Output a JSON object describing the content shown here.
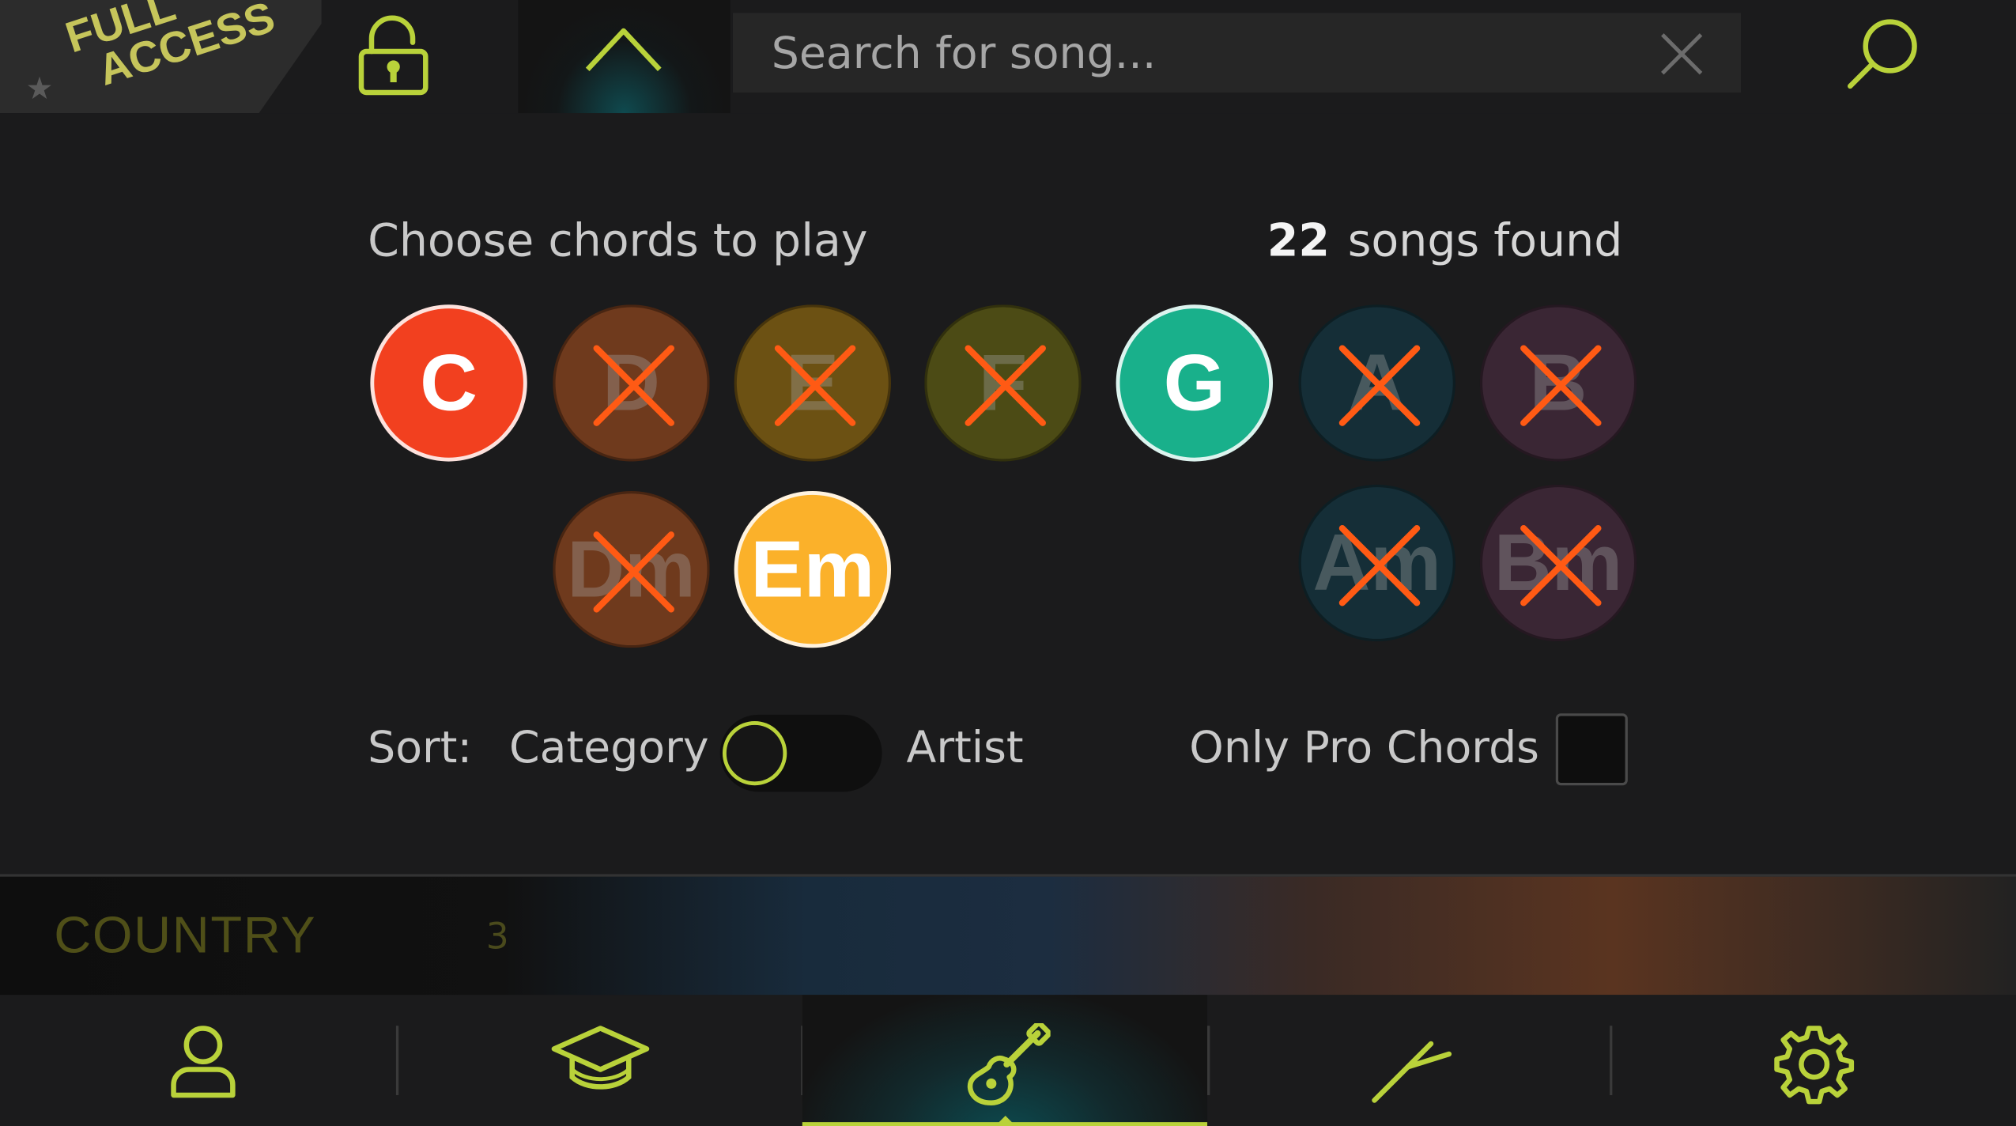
{
  "badge": {
    "line1": "FULL",
    "line2": "ACCESS"
  },
  "search": {
    "placeholder": "Search for song..."
  },
  "panel": {
    "title": "Choose chords to play",
    "songs_found_count": "22",
    "songs_found_label": "songs found"
  },
  "chords": [
    {
      "name": "C",
      "selected": true,
      "color": "#f2401f"
    },
    {
      "name": "D",
      "selected": false,
      "color": "#6f3a1d"
    },
    {
      "name": "E",
      "selected": false,
      "color": "#6c5113"
    },
    {
      "name": "F",
      "selected": false,
      "color": "#4c4b15"
    },
    {
      "name": "G",
      "selected": true,
      "color": "#19b08b"
    },
    {
      "name": "A",
      "selected": false,
      "color": "#152e37"
    },
    {
      "name": "B",
      "selected": false,
      "color": "#3a2634"
    },
    {
      "name": "Dm",
      "selected": false,
      "color": "#6f3a1d"
    },
    {
      "name": "Em",
      "selected": true,
      "color": "#fbb12a"
    },
    {
      "name": "Am",
      "selected": false,
      "color": "#152e37"
    },
    {
      "name": "Bm",
      "selected": false,
      "color": "#3a2634"
    }
  ],
  "sort": {
    "label": "Sort:",
    "option_left": "Category",
    "option_right": "Artist",
    "selected": "Category"
  },
  "pro_chords": {
    "label": "Only Pro Chords",
    "checked": false
  },
  "category_strip": {
    "name": "COUNTRY",
    "count": "3"
  },
  "nav": {
    "items": [
      {
        "name": "profile",
        "icon": "person-icon"
      },
      {
        "name": "lessons",
        "icon": "graduation-cap-icon"
      },
      {
        "name": "songs",
        "icon": "guitar-icon",
        "active": true
      },
      {
        "name": "tuner",
        "icon": "tuning-fork-icon"
      },
      {
        "name": "settings",
        "icon": "gear-icon"
      }
    ]
  },
  "colors": {
    "accent": "#b9d23a",
    "background": "#1b1b1c",
    "cross": "#ff5a14"
  }
}
